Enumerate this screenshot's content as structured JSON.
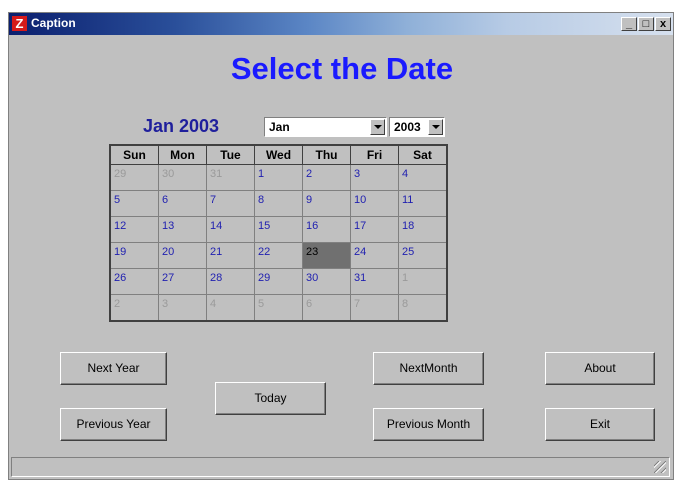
{
  "window": {
    "title": "Caption",
    "icon_letter": "Z"
  },
  "titlebar_buttons": {
    "minimize": "_",
    "maximize": "□",
    "close": "x"
  },
  "heading": "Select the Date",
  "month_label": "Jan 2003",
  "month_select": {
    "value": "Jan"
  },
  "year_select": {
    "value": "2003"
  },
  "calendar": {
    "days_header": [
      "Sun",
      "Mon",
      "Tue",
      "Wed",
      "Thu",
      "Fri",
      "Sat"
    ],
    "weeks": [
      [
        {
          "d": "29",
          "t": "oth"
        },
        {
          "d": "30",
          "t": "oth"
        },
        {
          "d": "31",
          "t": "oth"
        },
        {
          "d": "1",
          "t": "cur"
        },
        {
          "d": "2",
          "t": "cur"
        },
        {
          "d": "3",
          "t": "cur"
        },
        {
          "d": "4",
          "t": "cur"
        }
      ],
      [
        {
          "d": "5",
          "t": "cur"
        },
        {
          "d": "6",
          "t": "cur"
        },
        {
          "d": "7",
          "t": "cur"
        },
        {
          "d": "8",
          "t": "cur"
        },
        {
          "d": "9",
          "t": "cur"
        },
        {
          "d": "10",
          "t": "cur"
        },
        {
          "d": "11",
          "t": "cur"
        }
      ],
      [
        {
          "d": "12",
          "t": "cur"
        },
        {
          "d": "13",
          "t": "cur"
        },
        {
          "d": "14",
          "t": "cur"
        },
        {
          "d": "15",
          "t": "cur"
        },
        {
          "d": "16",
          "t": "cur"
        },
        {
          "d": "17",
          "t": "cur"
        },
        {
          "d": "18",
          "t": "cur"
        }
      ],
      [
        {
          "d": "19",
          "t": "cur"
        },
        {
          "d": "20",
          "t": "cur"
        },
        {
          "d": "21",
          "t": "cur"
        },
        {
          "d": "22",
          "t": "cur"
        },
        {
          "d": "23",
          "t": "sel"
        },
        {
          "d": "24",
          "t": "cur"
        },
        {
          "d": "25",
          "t": "cur"
        }
      ],
      [
        {
          "d": "26",
          "t": "cur"
        },
        {
          "d": "27",
          "t": "cur"
        },
        {
          "d": "28",
          "t": "cur"
        },
        {
          "d": "29",
          "t": "cur"
        },
        {
          "d": "30",
          "t": "cur"
        },
        {
          "d": "31",
          "t": "cur"
        },
        {
          "d": "1",
          "t": "oth"
        }
      ],
      [
        {
          "d": "2",
          "t": "oth"
        },
        {
          "d": "3",
          "t": "oth"
        },
        {
          "d": "4",
          "t": "oth"
        },
        {
          "d": "5",
          "t": "oth"
        },
        {
          "d": "6",
          "t": "oth"
        },
        {
          "d": "7",
          "t": "oth"
        },
        {
          "d": "8",
          "t": "oth"
        }
      ]
    ]
  },
  "buttons": {
    "next_year": "Next Year",
    "previous_year": "Previous Year",
    "today": "Today",
    "next_month": "NextMonth",
    "previous_month": "Previous Month",
    "about": "About",
    "exit": "Exit"
  },
  "colors": {
    "heading": "#1a1aff",
    "month_label": "#1f1f9c",
    "selected_day_bg": "#707070",
    "window_bg": "#c0c0c0"
  }
}
